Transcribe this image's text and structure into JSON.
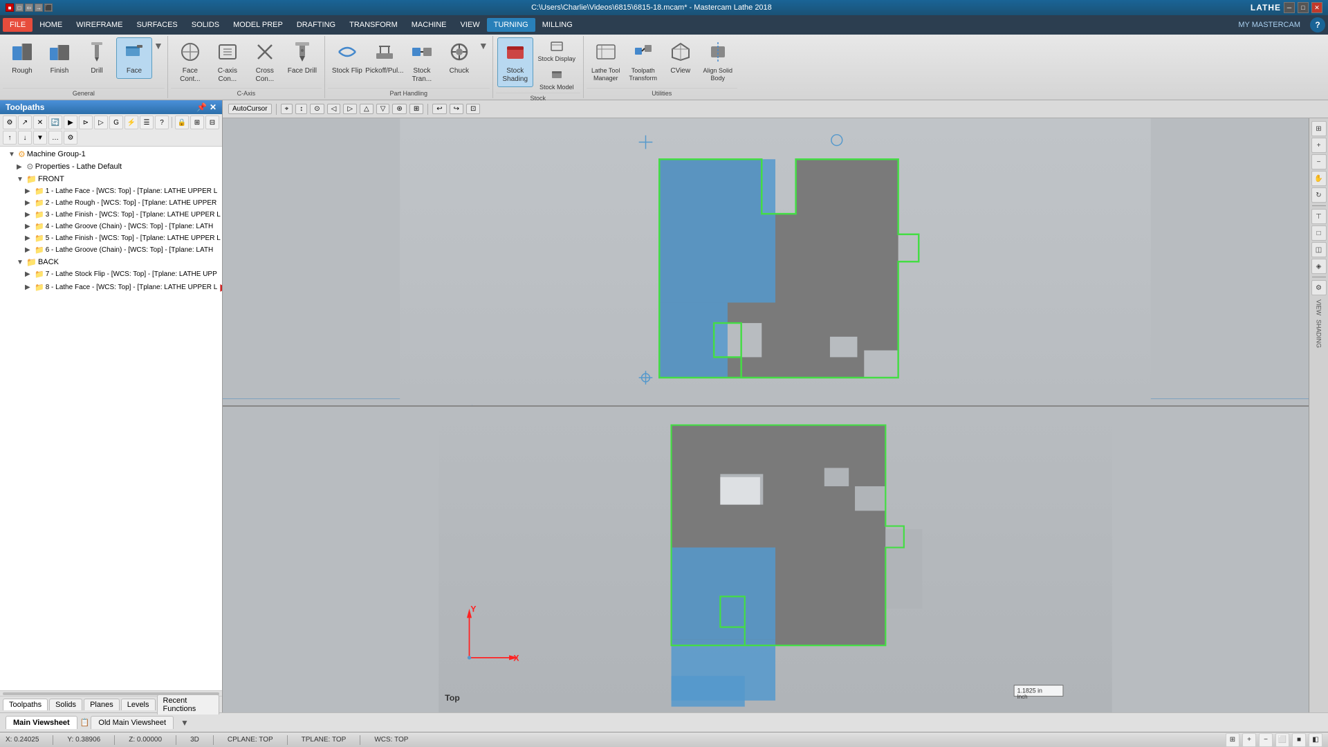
{
  "titlebar": {
    "title": "C:\\Users\\Charlie\\Videos\\6815\\6815-18.mcam* - Mastercam Lathe 2018",
    "app_section": "LATHE",
    "window_controls": [
      "minimize",
      "maximize",
      "close"
    ]
  },
  "menubar": {
    "items": [
      {
        "label": "FILE",
        "active": false
      },
      {
        "label": "HOME",
        "active": false
      },
      {
        "label": "WIREFRAME",
        "active": false
      },
      {
        "label": "SURFACES",
        "active": false
      },
      {
        "label": "SOLIDS",
        "active": false
      },
      {
        "label": "MODEL PREP",
        "active": false
      },
      {
        "label": "DRAFTING",
        "active": false
      },
      {
        "label": "TRANSFORM",
        "active": false
      },
      {
        "label": "MACHINE",
        "active": false
      },
      {
        "label": "VIEW",
        "active": false
      },
      {
        "label": "TURNING",
        "active": true
      },
      {
        "label": "MILLING",
        "active": false
      }
    ],
    "my_mastercam": "MY MASTERCAM"
  },
  "ribbon": {
    "general": {
      "label": "General",
      "buttons": [
        {
          "id": "rough",
          "label": "Rough",
          "icon": "⬛"
        },
        {
          "id": "finish",
          "label": "Finish",
          "icon": "⬛"
        },
        {
          "id": "drill",
          "label": "Drill",
          "icon": "⬛"
        },
        {
          "id": "face",
          "label": "Face",
          "icon": "⬛",
          "active": true
        }
      ]
    },
    "c_axis": {
      "label": "C-Axis",
      "buttons": [
        {
          "id": "face-cont",
          "label": "Face Cont...",
          "icon": "⬛"
        },
        {
          "id": "c-axis-con",
          "label": "C-axis Con...",
          "icon": "⬛"
        },
        {
          "id": "cross-con",
          "label": "Cross Con...",
          "icon": "⬛"
        },
        {
          "id": "face-drill",
          "label": "Face Drill",
          "icon": "⬛"
        }
      ]
    },
    "part_handling": {
      "label": "Part Handling",
      "buttons": [
        {
          "id": "stock-flip",
          "label": "Stock Flip",
          "icon": "⬛"
        },
        {
          "id": "pickoff",
          "label": "Pickoff/Pul...",
          "icon": "⬛"
        },
        {
          "id": "stock-tran",
          "label": "Stock Tran...",
          "icon": "⬛"
        },
        {
          "id": "chuck",
          "label": "Chuck",
          "icon": "⬛"
        }
      ]
    },
    "stock": {
      "label": "Stock",
      "buttons": [
        {
          "id": "stock-shading",
          "label": "Stock Shading",
          "icon": "⬛",
          "active": true
        },
        {
          "id": "stock-display",
          "label": "Stock Display",
          "icon": "⬛"
        },
        {
          "id": "stock-model",
          "label": "Stock Model",
          "icon": "⬛"
        }
      ]
    },
    "utilities": {
      "label": "Utilities",
      "buttons": [
        {
          "id": "lathe-tool-manager",
          "label": "Lathe Tool Manager",
          "icon": "⬛"
        },
        {
          "id": "toolpath-transform",
          "label": "Toolpath Transform",
          "icon": "⬛"
        },
        {
          "id": "cview",
          "label": "CView",
          "icon": "⬛"
        },
        {
          "id": "align-solid-body",
          "label": "Align Solid Body",
          "icon": "⬛"
        }
      ]
    }
  },
  "toolpaths_panel": {
    "title": "Toolpaths",
    "tree": [
      {
        "level": 1,
        "type": "group",
        "label": "Machine Group-1",
        "icon": "group"
      },
      {
        "level": 2,
        "type": "properties",
        "label": "Properties - Lathe Default",
        "icon": "gear"
      },
      {
        "level": 2,
        "type": "folder",
        "label": "FRONT",
        "icon": "folder"
      },
      {
        "level": 3,
        "type": "op",
        "label": "1 - Lathe Face - [WCS: Top] - [Tplane: LATHE UPPER L",
        "icon": "folder"
      },
      {
        "level": 3,
        "type": "op",
        "label": "2 - Lathe Rough - [WCS: Top] - [Tplane: LATHE UPPER",
        "icon": "folder"
      },
      {
        "level": 3,
        "type": "op",
        "label": "3 - Lathe Finish - [WCS: Top] - [Tplane: LATHE UPPER L",
        "icon": "folder"
      },
      {
        "level": 3,
        "type": "op",
        "label": "4 - Lathe Groove (Chain) - [WCS: Top] - [Tplane: LATH",
        "icon": "folder"
      },
      {
        "level": 3,
        "type": "op",
        "label": "5 - Lathe Finish - [WCS: Top] - [Tplane: LATHE UPPER L",
        "icon": "folder"
      },
      {
        "level": 3,
        "type": "op",
        "label": "6 - Lathe Groove (Chain) - [WCS: Top] - [Tplane: LATH",
        "icon": "folder"
      },
      {
        "level": 2,
        "type": "folder",
        "label": "BACK",
        "icon": "folder"
      },
      {
        "level": 3,
        "type": "op",
        "label": "7 - Lathe Stock Flip - [WCS: Top] - [Tplane: LATHE UPP",
        "icon": "folder"
      },
      {
        "level": 3,
        "type": "op-active",
        "label": "8 - Lathe Face - [WCS: Top] - [Tplane: LATHE UPPER L",
        "icon": "play"
      }
    ]
  },
  "panel_tabs": [
    {
      "label": "Toolpaths",
      "active": true
    },
    {
      "label": "Solids",
      "active": false
    },
    {
      "label": "Planes",
      "active": false
    },
    {
      "label": "Levels",
      "active": false
    },
    {
      "label": "Recent Functions",
      "active": false
    }
  ],
  "bottom_tabs": [
    {
      "label": "Main Viewsheet",
      "active": true
    },
    {
      "label": "Old Main Viewsheet",
      "active": false
    }
  ],
  "statusbar": {
    "x_label": "X:",
    "x_value": "0.24025",
    "y_label": "Y:",
    "y_value": "0.38906",
    "z_label": "Z:",
    "z_value": "0.00000",
    "mode": "3D",
    "cplane_label": "CPLANE:",
    "cplane_value": "TOP",
    "tplane_label": "TPLANE:",
    "tplane_value": "TOP",
    "wcs_label": "WCS:",
    "wcs_value": "TOP"
  },
  "viewport": {
    "view_label": "Top",
    "scale_value": "1.1825 in",
    "scale_unit": "Inch"
  },
  "viewport_toolbar": {
    "autocursor_label": "AutoCursor",
    "buttons": [
      "⬛",
      "🔄",
      "⬛",
      "⬛",
      "⬛",
      "⬛",
      "⬛",
      "⬛",
      "⬛",
      "⬛",
      "⬛",
      "⬛"
    ]
  }
}
